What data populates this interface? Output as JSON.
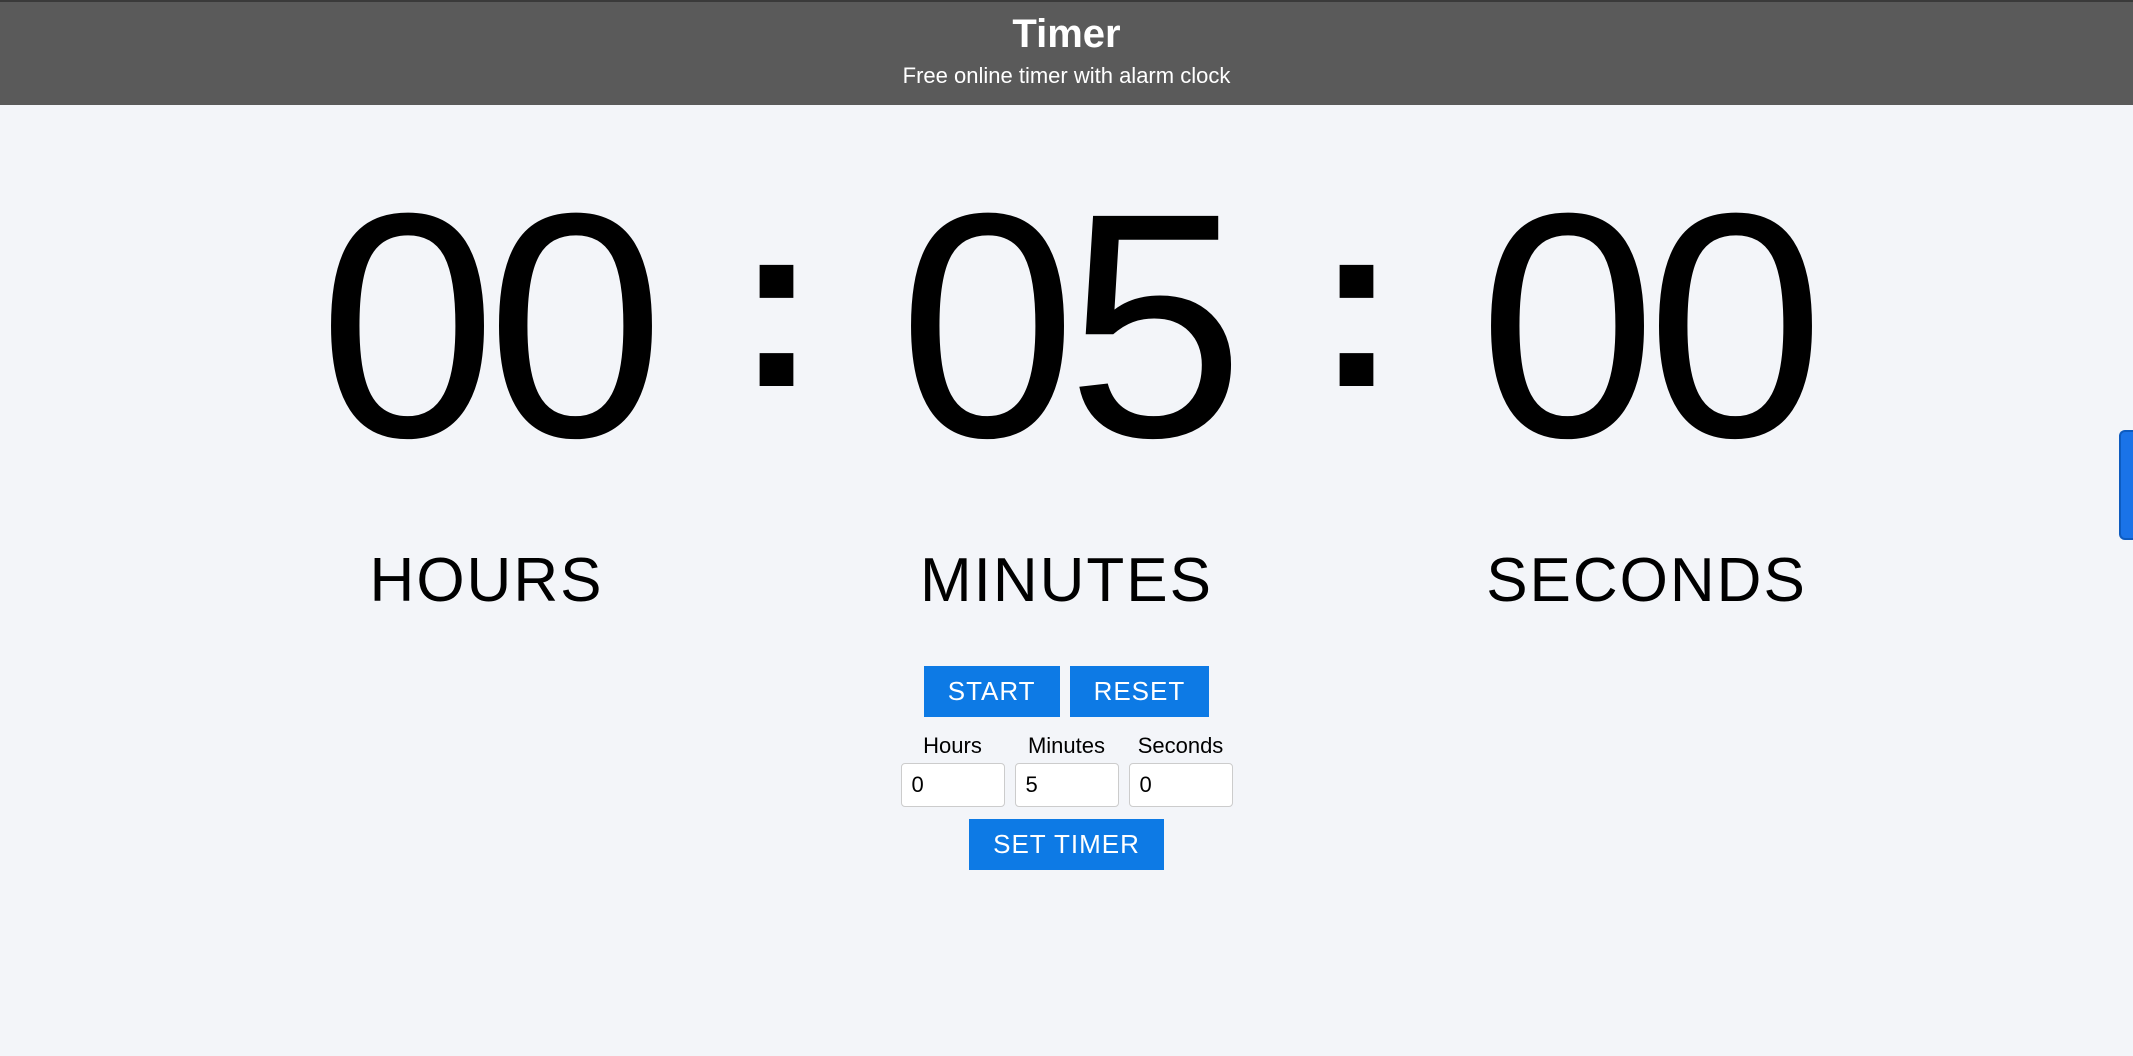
{
  "header": {
    "title": "Timer",
    "subtitle": "Free online timer with alarm clock"
  },
  "display": {
    "hours_value": "00",
    "hours_label": "HOURS",
    "minutes_value": "05",
    "minutes_label": "MINUTES",
    "seconds_value": "00",
    "seconds_label": "SECONDS",
    "separator": ":"
  },
  "controls": {
    "start_label": "START",
    "reset_label": "RESET",
    "set_timer_label": "SET TIMER"
  },
  "inputs": {
    "hours_label": "Hours",
    "hours_value": "0",
    "minutes_label": "Minutes",
    "minutes_value": "5",
    "seconds_label": "Seconds",
    "seconds_value": "0"
  }
}
